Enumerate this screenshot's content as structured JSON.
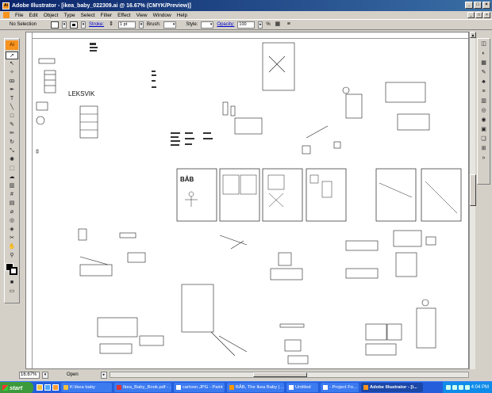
{
  "window": {
    "title": "Adobe Illustrator - [ikea_baby_022309.ai @ 16.67% (CMYK/Preview)]",
    "controls": {
      "minimize": "_",
      "maximize": "□",
      "close": "×"
    }
  },
  "menu": [
    "File",
    "Edit",
    "Object",
    "Type",
    "Select",
    "Filter",
    "Effect",
    "View",
    "Window",
    "Help"
  ],
  "control_palette": {
    "selection_status": "No Selection",
    "stroke_label": "Stroke:",
    "stroke_weight": "1 pt",
    "brush_label": "Brush:",
    "style_label": "Style:",
    "opacity_label": "Opacity:",
    "opacity_value": "100",
    "opacity_unit": "%"
  },
  "tools": {
    "logo": "Ai",
    "icons": [
      "selection-tool",
      "direct-selection-tool",
      "magic-wand-tool",
      "lasso-tool",
      "pen-tool",
      "type-tool",
      "line-tool",
      "rectangle-tool",
      "paintbrush-tool",
      "pencil-tool",
      "rotate-tool",
      "scale-tool",
      "warp-tool",
      "free-transform-tool",
      "symbol-sprayer-tool",
      "graph-tool",
      "mesh-tool",
      "gradient-tool",
      "eyedropper-tool",
      "blend-tool",
      "live-paint-tool",
      "scissors-tool",
      "hand-tool",
      "zoom-tool"
    ]
  },
  "canvas": {
    "doc_labels": [
      "LEKSVIK",
      "BÅB"
    ]
  },
  "status": {
    "zoom": "16.67%",
    "text": "Open"
  },
  "taskbar": {
    "start_label": "start",
    "tasks": [
      {
        "label": "K:\\ikea baby",
        "active": false
      },
      {
        "label": "Ikea_Baby_Book.pdf - ...",
        "active": false
      },
      {
        "label": "cartoon.JPG - Paint",
        "active": false
      },
      {
        "label": "BÅB, The Ikea Baby | ...",
        "active": false
      },
      {
        "label": "Untitled",
        "active": false
      },
      {
        "label": "- Project Fo...",
        "active": false
      },
      {
        "label": "Adobe Illustrator - [i...",
        "active": true
      }
    ],
    "clock": "4:04 PM"
  }
}
